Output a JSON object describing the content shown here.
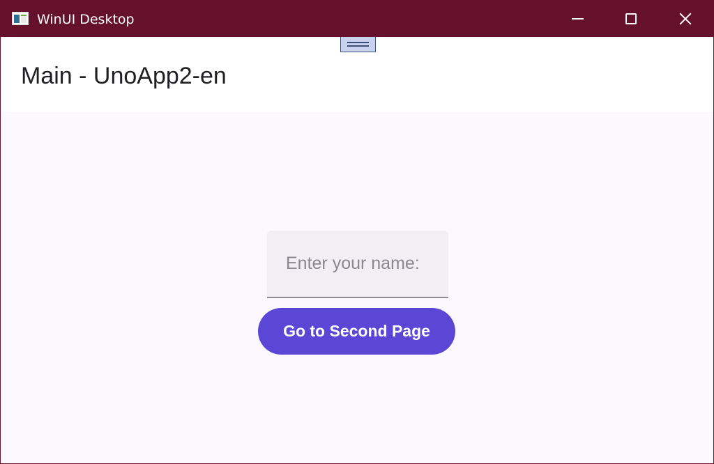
{
  "window": {
    "title": "WinUI Desktop",
    "app_icon": "app-window-icon",
    "controls": {
      "minimize_icon": "minimize-icon",
      "maximize_icon": "maximize-icon",
      "close_icon": "close-icon"
    },
    "titlebar_color": "#66112b"
  },
  "header": {
    "drag_handle_icon": "grip-handle-icon",
    "page_title": "Main - UnoApp2-en"
  },
  "main": {
    "name_input": {
      "value": "",
      "placeholder": "Enter your name:"
    },
    "navigate_button_label": "Go to Second Page",
    "accent_color": "#5b46d6"
  }
}
